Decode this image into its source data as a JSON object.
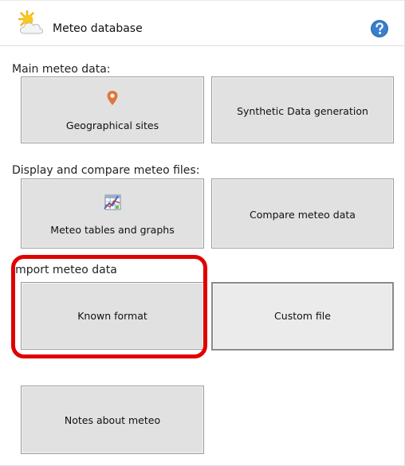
{
  "header": {
    "title": "Meteo database",
    "icon": "sun-cloud-icon",
    "help_icon": "help-icon"
  },
  "sections": [
    {
      "label": "Main meteo data:",
      "buttons": [
        {
          "label": "Geographical sites",
          "icon": "map-pin-icon"
        },
        {
          "label": "Synthetic Data generation"
        }
      ]
    },
    {
      "label": "Display and compare meteo files:",
      "buttons": [
        {
          "label": "Meteo tables and graphs",
          "icon": "table-chart-icon"
        },
        {
          "label": "Compare meteo data"
        }
      ]
    },
    {
      "label": "Import meteo data",
      "buttons": [
        {
          "label": "Known format"
        },
        {
          "label": "Custom file"
        }
      ]
    }
  ],
  "notes_button": {
    "label": "Notes about meteo"
  },
  "colors": {
    "accent_highlight": "#e00000",
    "button_face": "#e1e1e1",
    "help_blue": "#2f6fb7",
    "pin_orange": "#e0753a"
  }
}
